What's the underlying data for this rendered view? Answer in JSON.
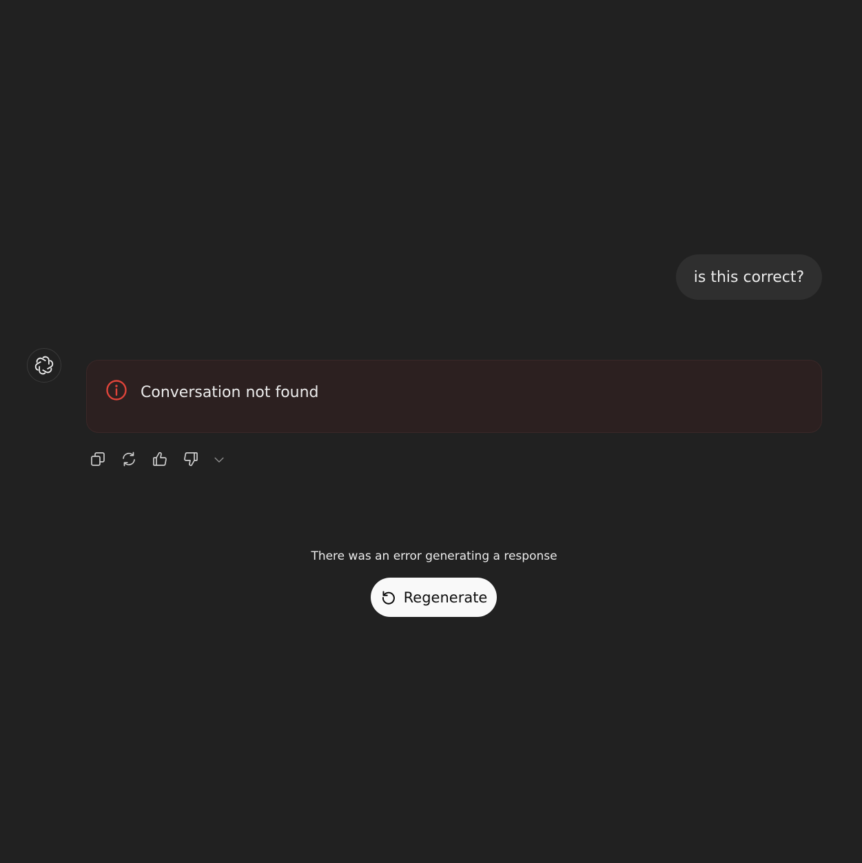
{
  "conversation": {
    "user_message": "is this correct?",
    "assistant": {
      "avatar_icon": "openai-logo-icon",
      "error_message": "Conversation not found",
      "error_icon": "info-circle-icon",
      "error_color": "#e0443a"
    }
  },
  "actions": [
    {
      "name": "copy",
      "icon": "copy-icon"
    },
    {
      "name": "regenerate",
      "icon": "refresh-icon"
    },
    {
      "name": "thumbs-up",
      "icon": "thumbs-up-icon"
    },
    {
      "name": "thumbs-down",
      "icon": "thumbs-down-icon"
    },
    {
      "name": "more",
      "icon": "chevron-down-icon"
    }
  ],
  "error_banner": {
    "status_text": "There was an error generating a response",
    "regenerate_label": "Regenerate"
  }
}
